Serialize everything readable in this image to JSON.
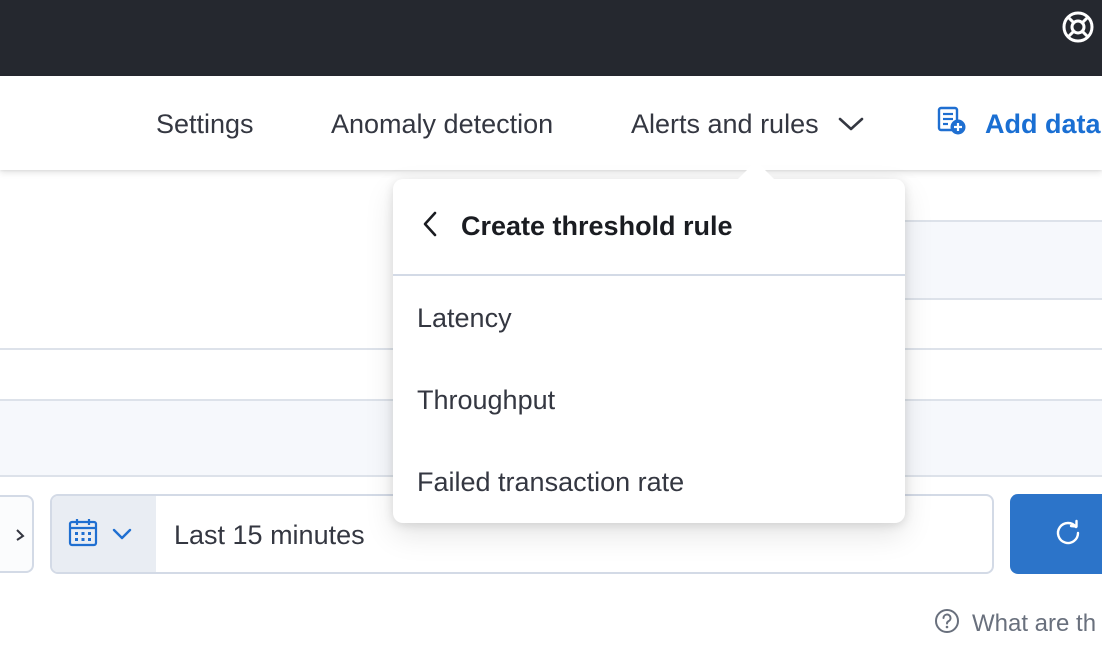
{
  "nav": {
    "settings": "Settings",
    "anomaly_detection": "Anomaly detection",
    "alerts_and_rules": "Alerts and rules",
    "add_data": "Add data"
  },
  "popover": {
    "title": "Create threshold rule",
    "items": [
      {
        "label": "Latency"
      },
      {
        "label": "Throughput"
      },
      {
        "label": "Failed transaction rate"
      }
    ]
  },
  "date_picker": {
    "value": "Last 15 minutes"
  },
  "footer": {
    "hint": "What are th"
  },
  "icons": {
    "help": "lifebuoy-icon",
    "chevron": "chevron-down-icon",
    "add_data": "add-data-icon",
    "back": "chevron-left-icon",
    "calendar": "calendar-icon",
    "refresh": "refresh-icon",
    "question": "question-circle-icon"
  },
  "colors": {
    "topbar": "#25282f",
    "link_blue": "#1a6fd3",
    "refresh_button": "#2c74c9"
  }
}
